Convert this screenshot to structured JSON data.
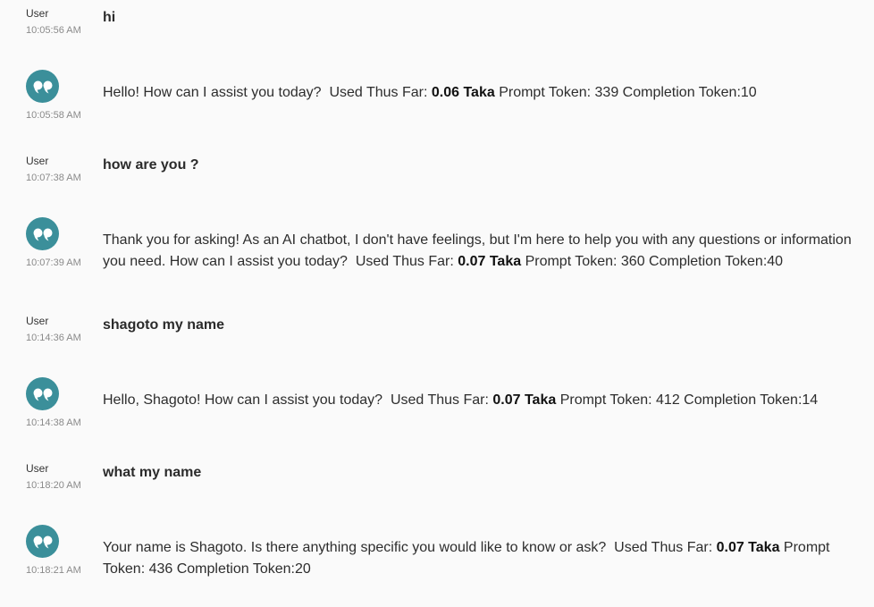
{
  "colors": {
    "avatar_bg": "#3b8f9a",
    "background": "#fafafa"
  },
  "assistant_icon": "quote-icon",
  "messages": [
    {
      "role": "user",
      "sender": "User",
      "time": "10:05:56 AM",
      "text": "hi"
    },
    {
      "role": "assistant",
      "time": "10:05:58 AM",
      "text": "Hello! How can I assist you today?",
      "used_label": "Used Thus Far:",
      "cost": "0.06 Taka",
      "tokens": "Prompt Token: 339 Completion Token:10"
    },
    {
      "role": "user",
      "sender": "User",
      "time": "10:07:38 AM",
      "text": "how are you ?"
    },
    {
      "role": "assistant",
      "time": "10:07:39 AM",
      "text": "Thank you for asking! As an AI chatbot, I don't have feelings, but I'm here to help you with any questions or information you need. How can I assist you today?",
      "used_label": "Used Thus Far:",
      "cost": "0.07 Taka",
      "tokens": "Prompt Token: 360 Completion Token:40"
    },
    {
      "role": "user",
      "sender": "User",
      "time": "10:14:36 AM",
      "text": "shagoto my name"
    },
    {
      "role": "assistant",
      "time": "10:14:38 AM",
      "text": "Hello, Shagoto! How can I assist you today?",
      "used_label": "Used Thus Far:",
      "cost": "0.07 Taka",
      "tokens": "Prompt Token: 412 Completion Token:14"
    },
    {
      "role": "user",
      "sender": "User",
      "time": "10:18:20 AM",
      "text": "what my name"
    },
    {
      "role": "assistant",
      "time": "10:18:21 AM",
      "text": "Your name is Shagoto. Is there anything specific you would like to know or ask?",
      "used_label": "Used Thus Far:",
      "cost": "0.07 Taka",
      "tokens": "Prompt Token: 436 Completion Token:20"
    }
  ]
}
